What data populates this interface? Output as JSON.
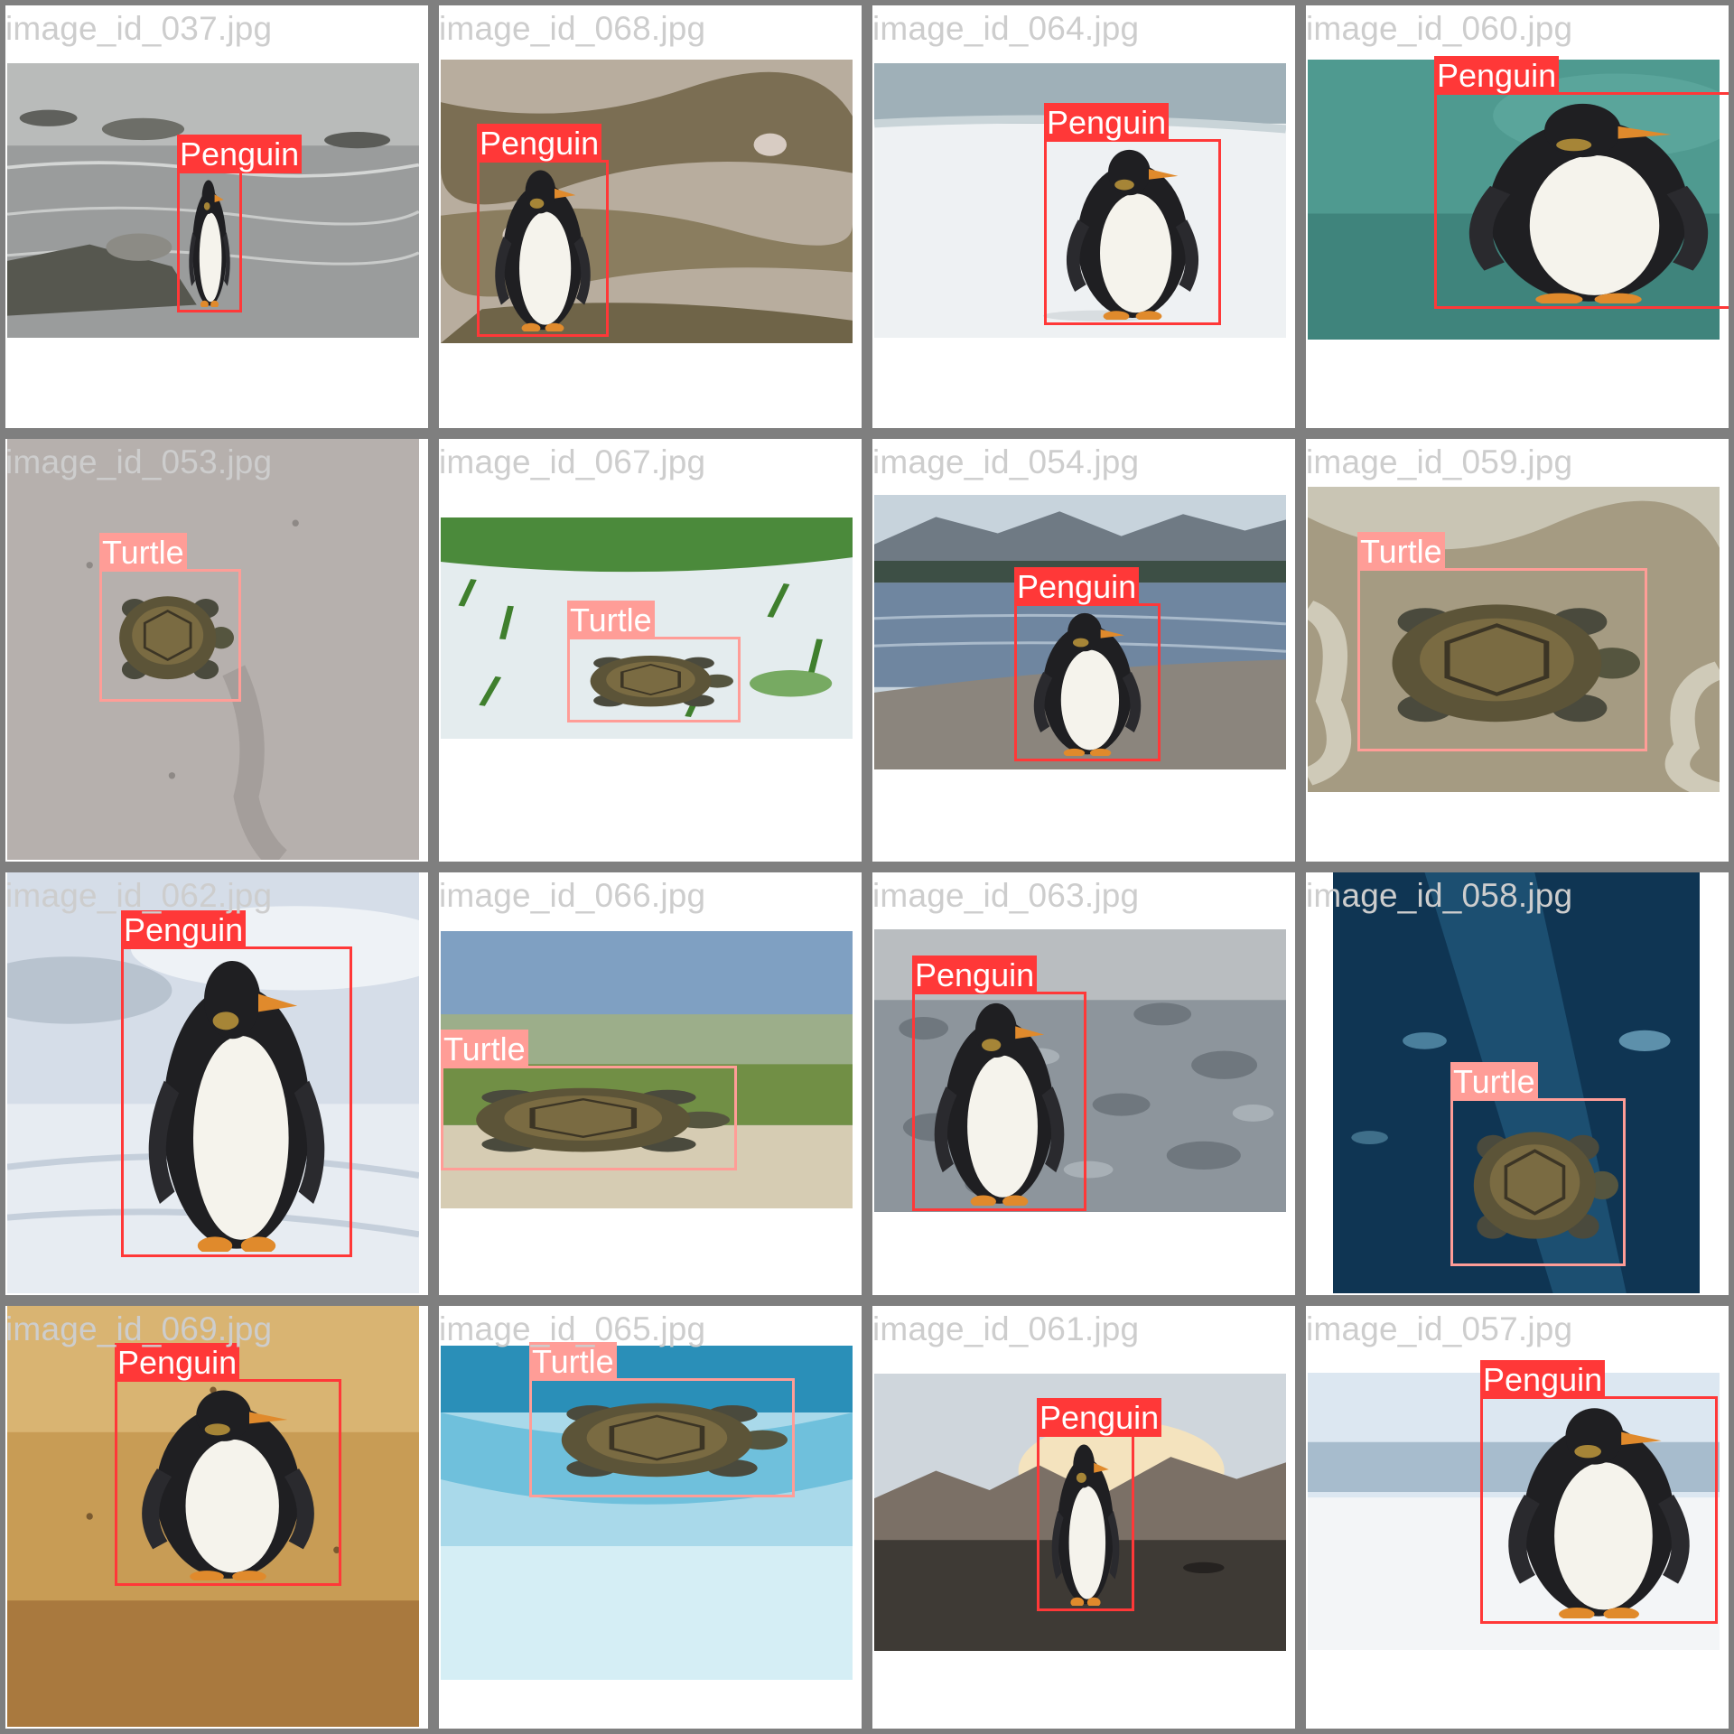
{
  "colors": {
    "penguin": "#ff3838",
    "turtle": "#ff9d97",
    "grid": "#7f7f7f",
    "filename_text": "#cdcdcd"
  },
  "class_names": {
    "penguin": "Penguin",
    "turtle": "Turtle"
  },
  "tiles": [
    {
      "filename": "image_id_037.jpg",
      "scene": "rocky-shore-water",
      "detections": [
        {
          "label": "Penguin"
        }
      ]
    },
    {
      "filename": "image_id_068.jpg",
      "scene": "snowy-moss-ground",
      "detections": [
        {
          "label": "Penguin"
        }
      ]
    },
    {
      "filename": "image_id_064.jpg",
      "scene": "pale-snow-beach",
      "detections": [
        {
          "label": "Penguin"
        }
      ]
    },
    {
      "filename": "image_id_060.jpg",
      "scene": "teal-water",
      "detections": [
        {
          "label": "Penguin"
        }
      ]
    },
    {
      "filename": "image_id_053.jpg",
      "scene": "grey-sand",
      "detections": [
        {
          "label": "Turtle"
        }
      ]
    },
    {
      "filename": "image_id_067.jpg",
      "scene": "snow-and-grass",
      "detections": [
        {
          "label": "Turtle"
        }
      ]
    },
    {
      "filename": "image_id_054.jpg",
      "scene": "lake-pebble-beach",
      "detections": [
        {
          "label": "Penguin"
        }
      ]
    },
    {
      "filename": "image_id_059.jpg",
      "scene": "wet-sand-foam",
      "detections": [
        {
          "label": "Turtle"
        }
      ]
    },
    {
      "filename": "image_id_062.jpg",
      "scene": "snowfield-sky",
      "detections": [
        {
          "label": "Penguin"
        }
      ]
    },
    {
      "filename": "image_id_066.jpg",
      "scene": "blurred-field",
      "detections": [
        {
          "label": "Turtle"
        }
      ]
    },
    {
      "filename": "image_id_063.jpg",
      "scene": "grey-pebbles",
      "detections": [
        {
          "label": "Penguin"
        }
      ]
    },
    {
      "filename": "image_id_058.jpg",
      "scene": "deep-blue-aquarium",
      "detections": [
        {
          "label": "Turtle"
        }
      ]
    },
    {
      "filename": "image_id_069.jpg",
      "scene": "golden-beach",
      "detections": [
        {
          "label": "Penguin"
        }
      ]
    },
    {
      "filename": "image_id_065.jpg",
      "scene": "shallow-turquoise-water",
      "detections": [
        {
          "label": "Turtle"
        }
      ]
    },
    {
      "filename": "image_id_061.jpg",
      "scene": "mountain-sunset-shore",
      "detections": [
        {
          "label": "Penguin"
        }
      ]
    },
    {
      "filename": "image_id_057.jpg",
      "scene": "snowy-blue-backdrop",
      "detections": [
        {
          "label": "Penguin"
        }
      ]
    }
  ]
}
